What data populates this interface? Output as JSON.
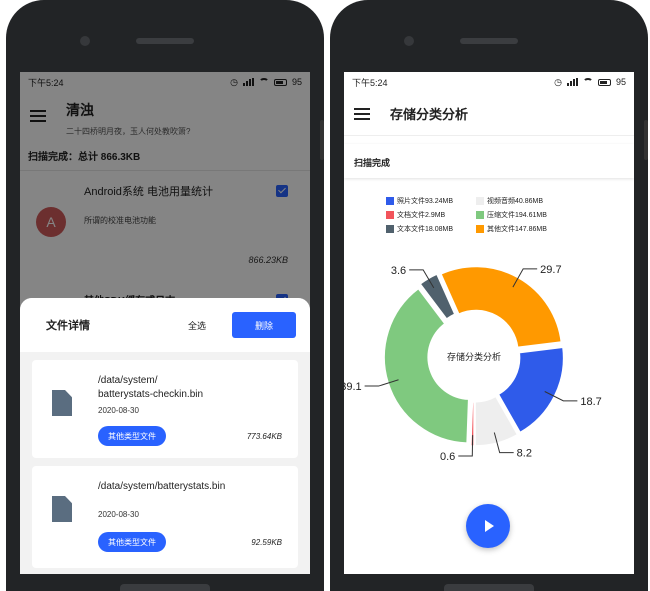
{
  "left": {
    "status": {
      "time": "下午5:24",
      "battery": "95"
    },
    "appbar": {
      "title": "清浊",
      "subtitle": "二十四桥明月夜，玉人何处教吹箫?"
    },
    "scan_summary": "扫描完成：总计 866.3KB",
    "items": [
      {
        "avatar": "A",
        "title": "Android系统 电池用量统计",
        "desc": "所谓的校准电池功能",
        "size": "866.23KB",
        "checked": true
      },
      {
        "title": "其他SDK缓存或日志",
        "checked": true
      }
    ],
    "sheet": {
      "title": "文件详情",
      "select_all": "全选",
      "delete": "删除",
      "files": [
        {
          "path": "/data/system/\nbatterystats-checkin.bin",
          "date": "2020-08-30",
          "type": "其他类型文件",
          "size": "773.64KB"
        },
        {
          "path": "/data/system/batterystats.bin",
          "date": "2020-08-30",
          "type": "其他类型文件",
          "size": "92.59KB"
        }
      ]
    }
  },
  "right": {
    "status": {
      "time": "下午5:24",
      "battery": "95"
    },
    "appbar": {
      "title": "存储分类分析"
    },
    "scan_label": "扫描完成",
    "chart_data": {
      "type": "pie",
      "title": "存储分类分析",
      "legend": [
        {
          "label": "照片文件93.24MB",
          "color": "#2f5bea"
        },
        {
          "label": "视频音频40.86MB",
          "color": "#eeeeee"
        },
        {
          "label": "文档文件2.9MB",
          "color": "#f2545b"
        },
        {
          "label": "压缩文件194.61MB",
          "color": "#7fc97f"
        },
        {
          "label": "文本文件18.08MB",
          "color": "#50616d"
        },
        {
          "label": "其他文件147.86MB",
          "color": "#ff9900"
        }
      ],
      "slices": [
        {
          "label": "29.7",
          "value": 29.7,
          "color": "#ff9900"
        },
        {
          "label": "18.7",
          "value": 18.7,
          "color": "#2f5bea"
        },
        {
          "label": "8.2",
          "value": 8.2,
          "color": "#eeeeee"
        },
        {
          "label": "0.6",
          "value": 0.6,
          "color": "#f2545b"
        },
        {
          "label": "39.1",
          "value": 39.1,
          "color": "#7fc97f"
        },
        {
          "label": "3.6",
          "value": 3.6,
          "color": "#50616d"
        }
      ]
    }
  }
}
